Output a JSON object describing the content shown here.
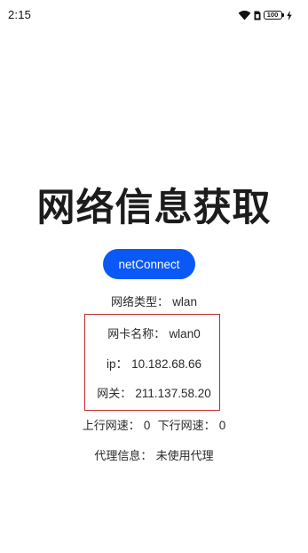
{
  "status_bar": {
    "time": "2:15",
    "battery_level": "100",
    "icons": [
      "wifi-icon",
      "sim-icon",
      "battery-icon",
      "charging-icon"
    ]
  },
  "page": {
    "title": "网络信息获取"
  },
  "button": {
    "label": "netConnect",
    "color": "#0a59f7"
  },
  "info": {
    "net_type_label": "网络类型：",
    "net_type_value": "wlan",
    "nic_name_label": "网卡名称：",
    "nic_name_value": "wlan0",
    "ip_label": "ip：",
    "ip_value": "10.182.68.66",
    "gateway_label": "网关：",
    "gateway_value": "211.137.58.20",
    "upload_label": "上行网速：",
    "upload_value": "0",
    "download_label": "下行网速：",
    "download_value": "0",
    "proxy_label": "代理信息：",
    "proxy_value": "未使用代理"
  },
  "colors": {
    "highlight_border": "#c62828"
  }
}
